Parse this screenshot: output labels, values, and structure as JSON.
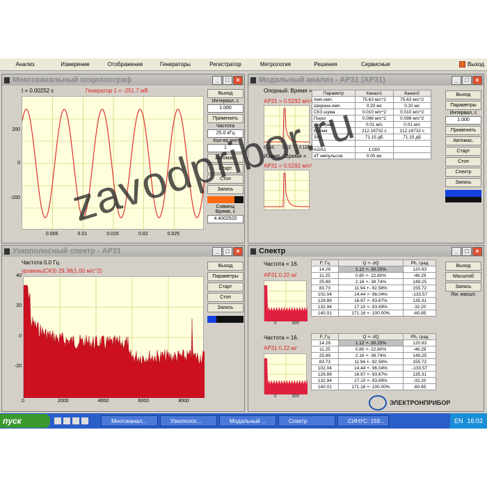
{
  "menubar": {
    "items": [
      "Анализ",
      "Измерение",
      "Отображение",
      "Генераторы",
      "Регистратор",
      "Метрология",
      "Решения",
      "Сервисные"
    ],
    "exit": "Выход"
  },
  "osc": {
    "title": "Многоканальный осциллограф",
    "time": "t = 0.00252 с",
    "generator": "Генератор 1 = -251.7 мВ",
    "yticks": [
      "200",
      "0",
      "-200"
    ],
    "xticks": [
      "0.005",
      "0.01",
      "0.015",
      "0.02",
      "0.025"
    ],
    "side": {
      "exit": "Выход",
      "interval": "Интервал, с",
      "interval_value": "1.000",
      "apply": "Применить",
      "freq": "Частота",
      "freq_value": "25.0 кГц",
      "channels": "Кол-во кнл",
      "channels_value": "1",
      "auto": "Автомас.",
      "start": "Старт",
      "stop": "Стоп",
      "record": "Запись",
      "combine": "Совмещ",
      "time": "Время, с",
      "time_value": "4.4002520"
    }
  },
  "modal": {
    "title": "Модальный анализ - AP31 (AP31)",
    "ref": "Опорный: Время =",
    "ref_value": "AP31 = 0.5292 м/с²",
    "meas": "Измер.: Время =",
    "meas_value": "AP31 = 0.5292 м/с²",
    "mini_x": [
      "0.145",
      "0.15",
      "0.155"
    ],
    "headers": [
      "Параметр",
      "Канал1",
      "Канал2"
    ],
    "rows": [
      [
        "Амп.имп.",
        "75.63 м/с^2",
        "75.63 м/с^2"
      ],
      [
        "Ширина имп.",
        "0.20 мс",
        "0.20 мс"
      ],
      [
        "СКЗ шума",
        "0.010 м/с^2",
        "0.010 м/с^2"
      ],
      [
        "Порог",
        "0.098 м/с^2",
        "0.098 м/с^2"
      ],
      [
        "Интеграл",
        "0.01 м/с",
        "0.01 м/с"
      ],
      [
        "Время",
        "212.16732 с",
        "212.16732 с"
      ],
      [
        "S/N",
        "71.15 дБ",
        "71.15 дБ"
      ],
      [
        "",
        "",
        " "
      ],
      [
        "A2/A1",
        "1.000",
        ""
      ],
      [
        "dT импульсов",
        "0.00 мс",
        ""
      ]
    ],
    "side": {
      "exit": "Выход",
      "params": "Параметры",
      "interval": "Интервал, с",
      "interval_value": "1.000",
      "apply": "Применить",
      "auto": "Автомас.",
      "start": "Старт",
      "stop": "Стоп",
      "spectrum": "Спектр",
      "record": "Запись"
    }
  },
  "narrow": {
    "title": "Узкополосный спектр - AP31",
    "freq": "Частота     0.0 Гц",
    "level": "уровень(СКЗ)  29.38(1.00 м/с^2)",
    "yticks": [
      "40",
      "20",
      "0",
      "-20"
    ],
    "xticks": [
      "0",
      "2000",
      "4000",
      "6000",
      "8000"
    ],
    "side": {
      "exit": "Выход",
      "params": "Параметры",
      "start": "Старт",
      "stop": "Стоп",
      "record": "Запись"
    }
  },
  "spectrum": {
    "title": "Спектр",
    "freq1": "Частота =  16.",
    "ch1": "AP31   0.22 м/",
    "freq2": "Частота =  16.",
    "ch2": "AP31   0.22 м/",
    "mini_x": [
      "0",
      "500"
    ],
    "headers": [
      "F, Гц",
      "Q    +- dQ",
      "Ph, град"
    ],
    "rows": [
      [
        "14.29",
        "1.12 +- 30.25%",
        "120.93"
      ],
      [
        "11.25",
        "0.80 +- 22.80%",
        "-46.29"
      ],
      [
        "25.89",
        "2.16 +- 38.74%",
        "149.25"
      ],
      [
        "83.73",
        "11.94 +- 92.58%",
        "155.72"
      ],
      [
        "102.04",
        "14.44 +- 96.04%",
        "-133.57"
      ],
      [
        "129.89",
        "16.97 +- 93.67%",
        "135.31"
      ],
      [
        "132.94",
        "17.10 +- 93.69%",
        "-32.20"
      ],
      [
        "140.01",
        "171.16 +- 100.00%",
        "-60.85"
      ]
    ],
    "side": {
      "exit": "Выход",
      "scale": "Масштаб",
      "record": "Запись",
      "log": "Лог. масшт."
    }
  },
  "taskbar": {
    "start": "пуск",
    "tasks": [
      "Многоканал...",
      "Узкополос...",
      "Модальный ...",
      "Спектр",
      "СИНУС: 159..."
    ],
    "lang": "EN",
    "clock": "16:02"
  },
  "watermark": "zavodpribor.ru",
  "brand": "ЭЛЕКТРОНПРИБОР"
}
